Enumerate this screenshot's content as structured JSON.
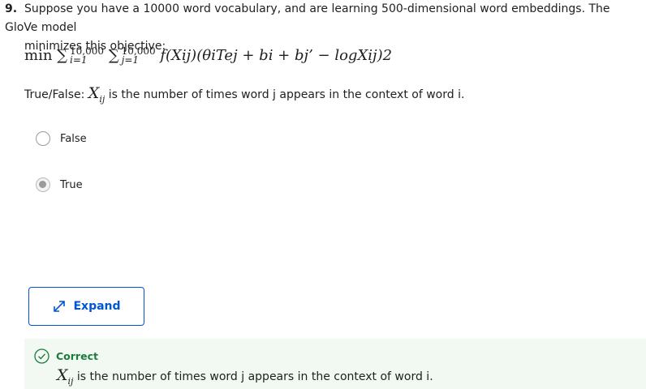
{
  "question": {
    "number": "9.",
    "line1": "Suppose you have a 10000 word vocabulary, and are learning 500-dimensional word embeddings. The GloVe model",
    "line2": "minimizes this objective:"
  },
  "formula": {
    "min": "min",
    "sum1_upper": "10,000",
    "sum1_lower": "i=1",
    "sum2_upper": "10,000",
    "sum2_lower": "j=1",
    "body": "f(Xij)(θiTej + bi + bj’ − logXij)2"
  },
  "statement": {
    "prefix": "True/False:",
    "var": "X",
    "var_sub": "ij",
    "suffix": "is the number of times word j appears in the context of word i."
  },
  "options": [
    {
      "label": "False",
      "selected": false
    },
    {
      "label": "True",
      "selected": true
    }
  ],
  "expand_button": {
    "label": "Expand"
  },
  "feedback": {
    "status": "Correct",
    "var": "X",
    "var_sub": "ij",
    "text": "is the number of times word j appears in the context of word i."
  },
  "colors": {
    "accent": "#0056d2",
    "correct": "#1d7c3b",
    "feedback_bg": "#f2f9f3"
  }
}
